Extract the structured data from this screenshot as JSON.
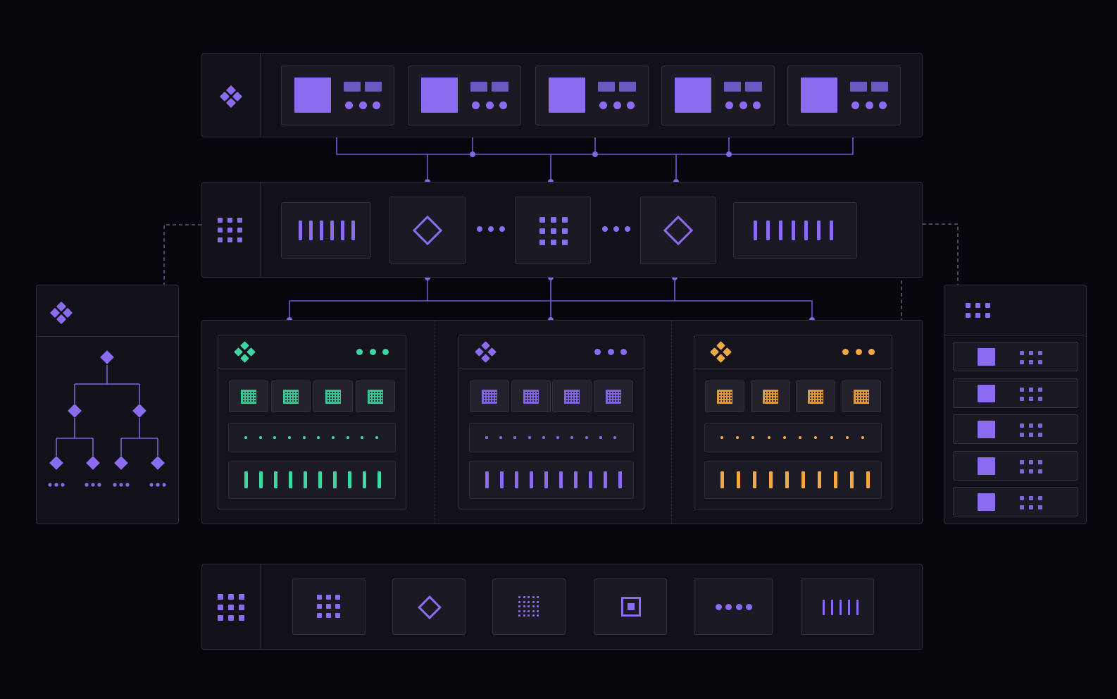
{
  "colors": {
    "background": "#07060d",
    "panel": "#121119",
    "card": "#1b1a24",
    "border": "#2e2c3b",
    "accent_purple": "#8b6cf0",
    "accent_purple_muted": "#6a58c0",
    "accent_green": "#3ed6a0",
    "accent_orange": "#f2a844",
    "connector": "#6b5ad0"
  },
  "icons": {
    "top_rail": "diamond-cluster-icon",
    "middle_rail": "dot-grid-icon",
    "bottom_rail": "dot-grid-icon",
    "left_panel": "diamond-cluster-icon",
    "right_panel": "dot-grid-icon",
    "tree": "hierarchy-tree-icon"
  },
  "top_row": {
    "module_count": 5
  },
  "middle_row": {
    "items": [
      "bars",
      "diamond",
      "ellipsis",
      "dot-grid",
      "ellipsis",
      "diamond",
      "bars"
    ]
  },
  "lanes": [
    {
      "accent": "#3ed6a0",
      "theme": "green"
    },
    {
      "accent": "#8b6cf0",
      "theme": "purple"
    },
    {
      "accent": "#f2a844",
      "theme": "orange"
    }
  ],
  "right_panel": {
    "row_count": 5
  },
  "bottom_row": {
    "steps": [
      "dot-grid",
      "diamond",
      "fine-grid",
      "square-target",
      "ellipsis",
      "bars"
    ]
  }
}
